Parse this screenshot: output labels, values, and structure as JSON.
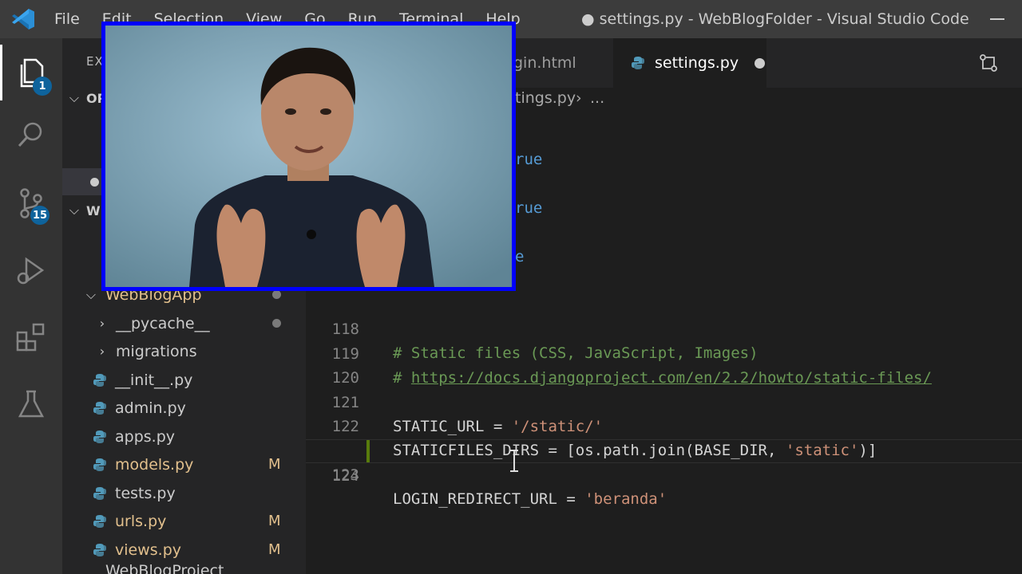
{
  "titlebar": {
    "menu": [
      "File",
      "Edit",
      "Selection",
      "View",
      "Go",
      "Run",
      "Terminal",
      "Help"
    ],
    "window_title": "● settings.py - WebBlogFolder - Visual Studio Code"
  },
  "activity": {
    "explorer_badge": "1",
    "scm_badge": "15"
  },
  "sidebar": {
    "title": "EX",
    "open_editors_label": "OP",
    "workspace_label": "W",
    "folder": "WebBlogApp",
    "items": [
      {
        "name": "__pycache__",
        "type": "folder",
        "status": ""
      },
      {
        "name": "migrations",
        "type": "folder",
        "status": ""
      },
      {
        "name": "__init__.py",
        "type": "file",
        "status": ""
      },
      {
        "name": "admin.py",
        "type": "file",
        "status": ""
      },
      {
        "name": "apps.py",
        "type": "file",
        "status": ""
      },
      {
        "name": "models.py",
        "type": "file",
        "status": "M"
      },
      {
        "name": "tests.py",
        "type": "file",
        "status": ""
      },
      {
        "name": "urls.py",
        "type": "file",
        "status": "M"
      },
      {
        "name": "views.py",
        "type": "file",
        "status": "M"
      }
    ],
    "next_folder": "WebBlogProject"
  },
  "tabs": {
    "inactive": "gin.html",
    "active": "settings.py"
  },
  "breadcrumbs": {
    "file": "tings.py",
    "more": "..."
  },
  "editor": {
    "partial_lines": [
      "rue",
      "rue",
      "e"
    ],
    "lines": [
      {
        "n": "118",
        "kind": "comment",
        "text": "# Static files (CSS, JavaScript, Images)"
      },
      {
        "n": "119",
        "kind": "link",
        "prefix": "# ",
        "text": "https://docs.djangoproject.com/en/2.2/howto/static-files/"
      },
      {
        "n": "120",
        "kind": "blank",
        "text": ""
      },
      {
        "n": "121",
        "kind": "assign",
        "var": "STATIC_URL = ",
        "value": "'/static/'"
      },
      {
        "n": "122",
        "kind": "plain",
        "pre": "STATICFILES_DIRS = [os.path.join(BASE_DIR, ",
        "value": "'static'",
        "post": ")]"
      },
      {
        "n": "123",
        "kind": "assign",
        "var": "LOGIN_REDIRECT_URL = ",
        "value": "'beranda'"
      },
      {
        "n": "124",
        "kind": "blank",
        "text": ""
      }
    ]
  },
  "colors": {
    "titlebar": "#3c3c3c",
    "activitybar": "#333333",
    "sidebar": "#252526",
    "editor": "#1e1e1e",
    "webcam_border": "#0000ff",
    "modified": "#e2c08d"
  }
}
